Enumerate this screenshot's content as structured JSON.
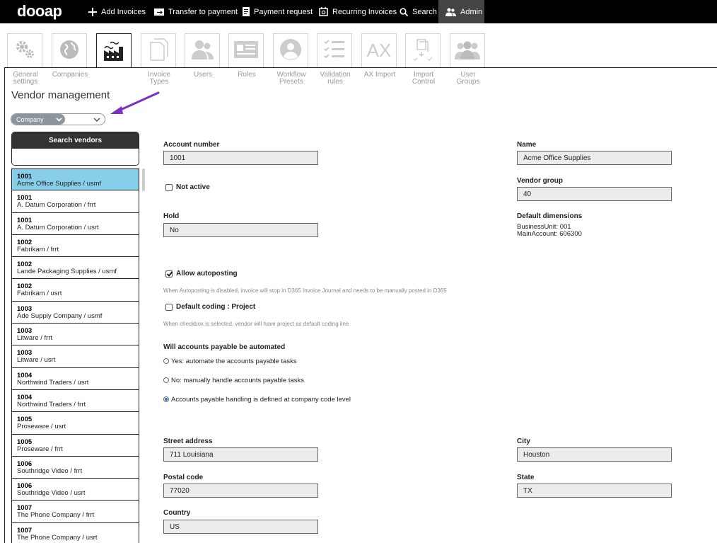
{
  "nav": {
    "brand": "dooap",
    "items": [
      {
        "label": "Add Invoices",
        "icon": "plus-icon"
      },
      {
        "label": "Transfer to payment",
        "icon": "transfer-icon"
      },
      {
        "label": "Payment request",
        "icon": "document-icon"
      },
      {
        "label": "Recurring Invoices",
        "icon": "recurring-icon"
      },
      {
        "label": "Search",
        "icon": "search-icon"
      },
      {
        "label": "Admin",
        "icon": "users-icon"
      }
    ]
  },
  "admin_tabs": [
    {
      "label": "General settings",
      "icon": "gears-icon"
    },
    {
      "label": "Companies",
      "icon": "globe-icon"
    },
    {
      "label": "",
      "icon": "factory-icon"
    },
    {
      "label": "Invoice Types",
      "icon": "documents-icon"
    },
    {
      "label": "Users",
      "icon": "users-icon"
    },
    {
      "label": "Roles",
      "icon": "id-card-icon"
    },
    {
      "label": "Workflow Presets",
      "icon": "user-circle-icon"
    },
    {
      "label": "Validation rules",
      "icon": "checklist-icon"
    },
    {
      "label": "AX Import",
      "icon": "ax-icon"
    },
    {
      "label": "Import Control",
      "icon": "import-control-icon"
    },
    {
      "label": "User Groups",
      "icon": "user-group-icon"
    }
  ],
  "ax_text": "AX",
  "page_title": "Vendor management",
  "company_filter": {
    "label": "Company",
    "value": ""
  },
  "vendor_search": {
    "title": "Search vendors",
    "value": ""
  },
  "vendors": [
    {
      "number": "1001",
      "name": "Acme Office Supplies / usmf",
      "selected": true
    },
    {
      "number": "1001",
      "name": "A. Datum Corporation / frrt"
    },
    {
      "number": "1001",
      "name": "A. Datum Corporation / usrt"
    },
    {
      "number": "1002",
      "name": "Fabrikam / frrt"
    },
    {
      "number": "1002",
      "name": "Lande Packaging Supplies / usmf"
    },
    {
      "number": "1002",
      "name": "Fabrikam / usrt"
    },
    {
      "number": "1003",
      "name": "Ade Supply Company / usmf"
    },
    {
      "number": "1003",
      "name": "Litware / frrt"
    },
    {
      "number": "1003",
      "name": "Litware / usrt"
    },
    {
      "number": "1004",
      "name": "Northwind Traders / usrt"
    },
    {
      "number": "1004",
      "name": "Northwind Traders / frrt"
    },
    {
      "number": "1005",
      "name": "Proseware / usrt"
    },
    {
      "number": "1005",
      "name": "Proseware / frrt"
    },
    {
      "number": "1006",
      "name": "Southridge Video / frrt"
    },
    {
      "number": "1006",
      "name": "Southridge Video / usrt"
    },
    {
      "number": "1007",
      "name": "The Phone Company / frrt"
    },
    {
      "number": "1007",
      "name": "The Phone Company / usrt"
    }
  ],
  "form": {
    "account_number": {
      "label": "Account number",
      "value": "1001"
    },
    "name": {
      "label": "Name",
      "value": "Acme Office Supplies"
    },
    "not_active": {
      "label": "Not active",
      "checked": false
    },
    "vendor_group": {
      "label": "Vendor group",
      "value": "40"
    },
    "hold": {
      "label": "Hold",
      "value": "No"
    },
    "default_dimensions": {
      "label": "Default dimensions",
      "line1": "BusinessUnit: 001",
      "line2": "MainAccount: 606300"
    },
    "allow_autoposting": {
      "label": "Allow autoposting",
      "checked": true,
      "hint": "When Autoposting is disabled, invoice will stop in D365 Invoice Journal and needs to be manually posted in D365"
    },
    "default_coding": {
      "label": "Default coding : Project",
      "checked": false,
      "hint": "When checkbox is selected, vendor will have project as default coding line"
    },
    "ap_automated": {
      "label": "Will accounts payable be automated",
      "options": [
        {
          "label": "Yes: automate the accounts payable tasks",
          "selected": false
        },
        {
          "label": "No: manually handle accounts payable tasks",
          "selected": false
        },
        {
          "label": "Accounts payable handling is defined at company code level",
          "selected": true
        }
      ]
    },
    "street_address": {
      "label": "Street address",
      "value": "711 Louisiana"
    },
    "city": {
      "label": "City",
      "value": "Houston"
    },
    "postal_code": {
      "label": "Postal code",
      "value": "77020"
    },
    "state": {
      "label": "State",
      "value": "TX"
    },
    "country": {
      "label": "Country",
      "value": "US"
    }
  },
  "colors": {
    "selected_row": "#87ceeb",
    "arrow": "#7b2fc9",
    "radio_on": "#1a6ed8"
  }
}
